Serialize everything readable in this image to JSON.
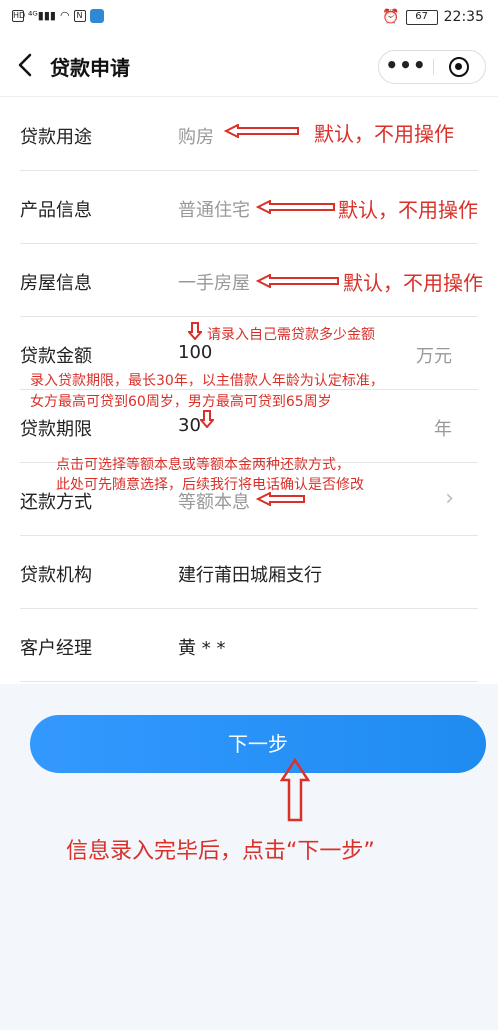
{
  "status_bar": {
    "left_icons": [
      "hd-icon",
      "signal-4g-icon",
      "wifi-icon",
      "nfc-icon",
      "app-icon"
    ],
    "alarm_icon": "alarm-icon",
    "battery": "67",
    "time": "22:35"
  },
  "navbar": {
    "title": "贷款申请",
    "more": "•••"
  },
  "form": {
    "rows": [
      {
        "label": "贷款用途",
        "value": "购房"
      },
      {
        "label": "产品信息",
        "value": "普通住宅"
      },
      {
        "label": "房屋信息",
        "value": "一手房屋"
      },
      {
        "label": "贷款金额",
        "value": "100",
        "unit": "万元"
      },
      {
        "label": "贷款期限",
        "value": "30",
        "unit": "年"
      },
      {
        "label": "还款方式",
        "value": "等额本息",
        "chevron": "›"
      },
      {
        "label": "贷款机构",
        "value": "建行莆田城厢支行"
      },
      {
        "label": "客户经理",
        "value": "黄 * *"
      }
    ]
  },
  "next_button": "下一步",
  "annotations": {
    "default1": "默认，不用操作",
    "default2": "默认，不用操作",
    "default3": "默认，不用操作",
    "amount": "请录入自己需贷款多少金额",
    "term_line1": "录入贷款期限，最长30年，以主借款人年龄为认定标准，",
    "term_line2": "女方最高可贷到60周岁，男方最高可贷到65周岁",
    "repay_line1": "点击可选择等额本息或等额本金两种还款方式，",
    "repay_line2": "此处可先随意选择，后续我行将电话确认是否修改",
    "bottom": "信息录入完毕后，点击“下一步”"
  },
  "colors": {
    "annotation": "#d9302a",
    "button": "#2a8ff5",
    "value_grey": "#999999"
  }
}
